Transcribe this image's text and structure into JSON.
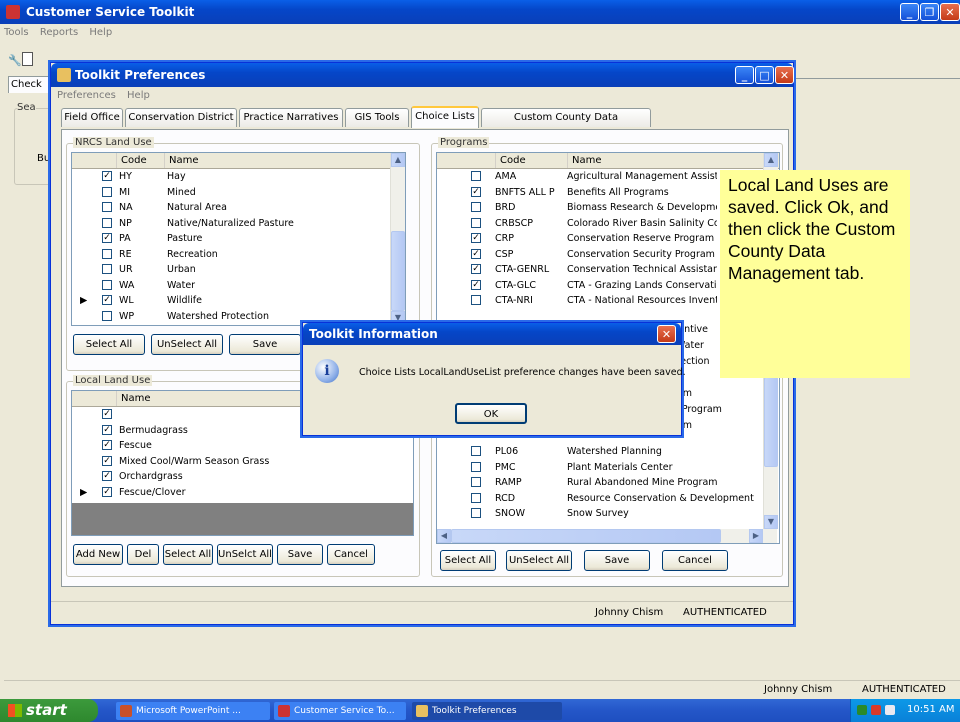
{
  "main_window": {
    "title": "Customer Service Toolkit",
    "menu": [
      "Tools",
      "Reports",
      "Help"
    ],
    "tab_partial": "Check",
    "group_partial": "Sea",
    "button_partial": "Bu"
  },
  "prefs_window": {
    "title": "Toolkit Preferences",
    "menu": [
      "Preferences",
      "Help"
    ],
    "tabs": [
      "Field Office",
      "Conservation District",
      "Practice Narratives",
      "GIS Tools",
      "Choice Lists",
      "Custom County Data Management"
    ],
    "active_tab": "Choice Lists",
    "nrcs_land_use": {
      "label": "NRCS Land Use",
      "headers": [
        "Code",
        "Name"
      ],
      "rows": [
        {
          "checked": true,
          "code": "HY",
          "name": "Hay"
        },
        {
          "checked": false,
          "code": "MI",
          "name": "Mined"
        },
        {
          "checked": false,
          "code": "NA",
          "name": "Natural Area"
        },
        {
          "checked": false,
          "code": "NP",
          "name": "Native/Naturalized Pasture"
        },
        {
          "checked": true,
          "code": "PA",
          "name": "Pasture"
        },
        {
          "checked": false,
          "code": "RE",
          "name": "Recreation"
        },
        {
          "checked": false,
          "code": "UR",
          "name": "Urban"
        },
        {
          "checked": false,
          "code": "WA",
          "name": "Water"
        },
        {
          "checked": true,
          "code": "WL",
          "name": "Wildlife",
          "current": true
        },
        {
          "checked": false,
          "code": "WP",
          "name": "Watershed Protection"
        }
      ],
      "buttons": [
        "Select All",
        "UnSelect All",
        "Save"
      ]
    },
    "local_land_use": {
      "label": "Local Land Use",
      "headers": [
        "Name"
      ],
      "rows": [
        {
          "checked": true,
          "name": ""
        },
        {
          "checked": true,
          "name": "Bermudagrass"
        },
        {
          "checked": true,
          "name": "Fescue"
        },
        {
          "checked": true,
          "name": "Mixed Cool/Warm Season Grass"
        },
        {
          "checked": true,
          "name": "Orchardgrass"
        },
        {
          "checked": true,
          "name": "Fescue/Clover",
          "current": true
        }
      ],
      "buttons": [
        "Add New",
        "Del",
        "Select All",
        "UnSelct All",
        "Save",
        "Cancel"
      ]
    },
    "programs": {
      "label": "Programs",
      "headers": [
        "Code",
        "Name"
      ],
      "rows_top": [
        {
          "checked": false,
          "code": "AMA",
          "name": "Agricultural Management Assista"
        },
        {
          "checked": true,
          "code": "BNFTS ALL P",
          "name": "Benefits All Programs"
        },
        {
          "checked": false,
          "code": "BRD",
          "name": "Biomass Research & Developmer"
        },
        {
          "checked": false,
          "code": "CRBSCP",
          "name": "Colorado River Basin Salinity Co"
        },
        {
          "checked": true,
          "code": "CRP",
          "name": "Conservation Reserve Program"
        },
        {
          "checked": true,
          "code": "CSP",
          "name": "Conservation Security Program"
        },
        {
          "checked": true,
          "code": "CTA-GENRL",
          "name": "Conservation Technical Assistanc"
        },
        {
          "checked": true,
          "code": "CTA-GLC",
          "name": "CTA - Grazing Lands Conservatio"
        },
        {
          "checked": false,
          "code": "CTA-NRI",
          "name": "CTA - National Resources Invent"
        }
      ],
      "partial_right": [
        "ncentive",
        "e Water",
        "rotection",
        "m",
        "gram",
        "on Program",
        "gram"
      ],
      "rows_bottom": [
        {
          "checked": false,
          "code": "PL06",
          "name": "Watershed Planning"
        },
        {
          "checked": false,
          "code": "PMC",
          "name": "Plant Materials Center"
        },
        {
          "checked": false,
          "code": "RAMP",
          "name": "Rural Abandoned Mine Program"
        },
        {
          "checked": false,
          "code": "RCD",
          "name": "Resource Conservation & Development"
        },
        {
          "checked": false,
          "code": "SNOW",
          "name": "Snow Survey"
        }
      ],
      "buttons": [
        "Select All",
        "UnSelect All",
        "Save",
        "Cancel"
      ]
    },
    "status_user": "Johnny Chism",
    "status_auth": "AUTHENTICATED"
  },
  "dialog": {
    "title": "Toolkit Information",
    "message": "Choice Lists LocalLandUseList preference changes have been saved.",
    "ok_label": "OK"
  },
  "callout": {
    "text": "Local Land Uses are saved. Click Ok, and then click the Custom County Data Management tab."
  },
  "main_status": {
    "user": "Johnny Chism",
    "auth": "AUTHENTICATED"
  },
  "taskbar": {
    "start": "start",
    "items": [
      "Microsoft PowerPoint ...",
      "Customer Service To...",
      "Toolkit Preferences"
    ],
    "clock": "10:51 AM"
  },
  "colors": {
    "title_blue": "#0a5fe8",
    "callout_bg": "#ffff99",
    "start_green": "#3c9a3c"
  }
}
